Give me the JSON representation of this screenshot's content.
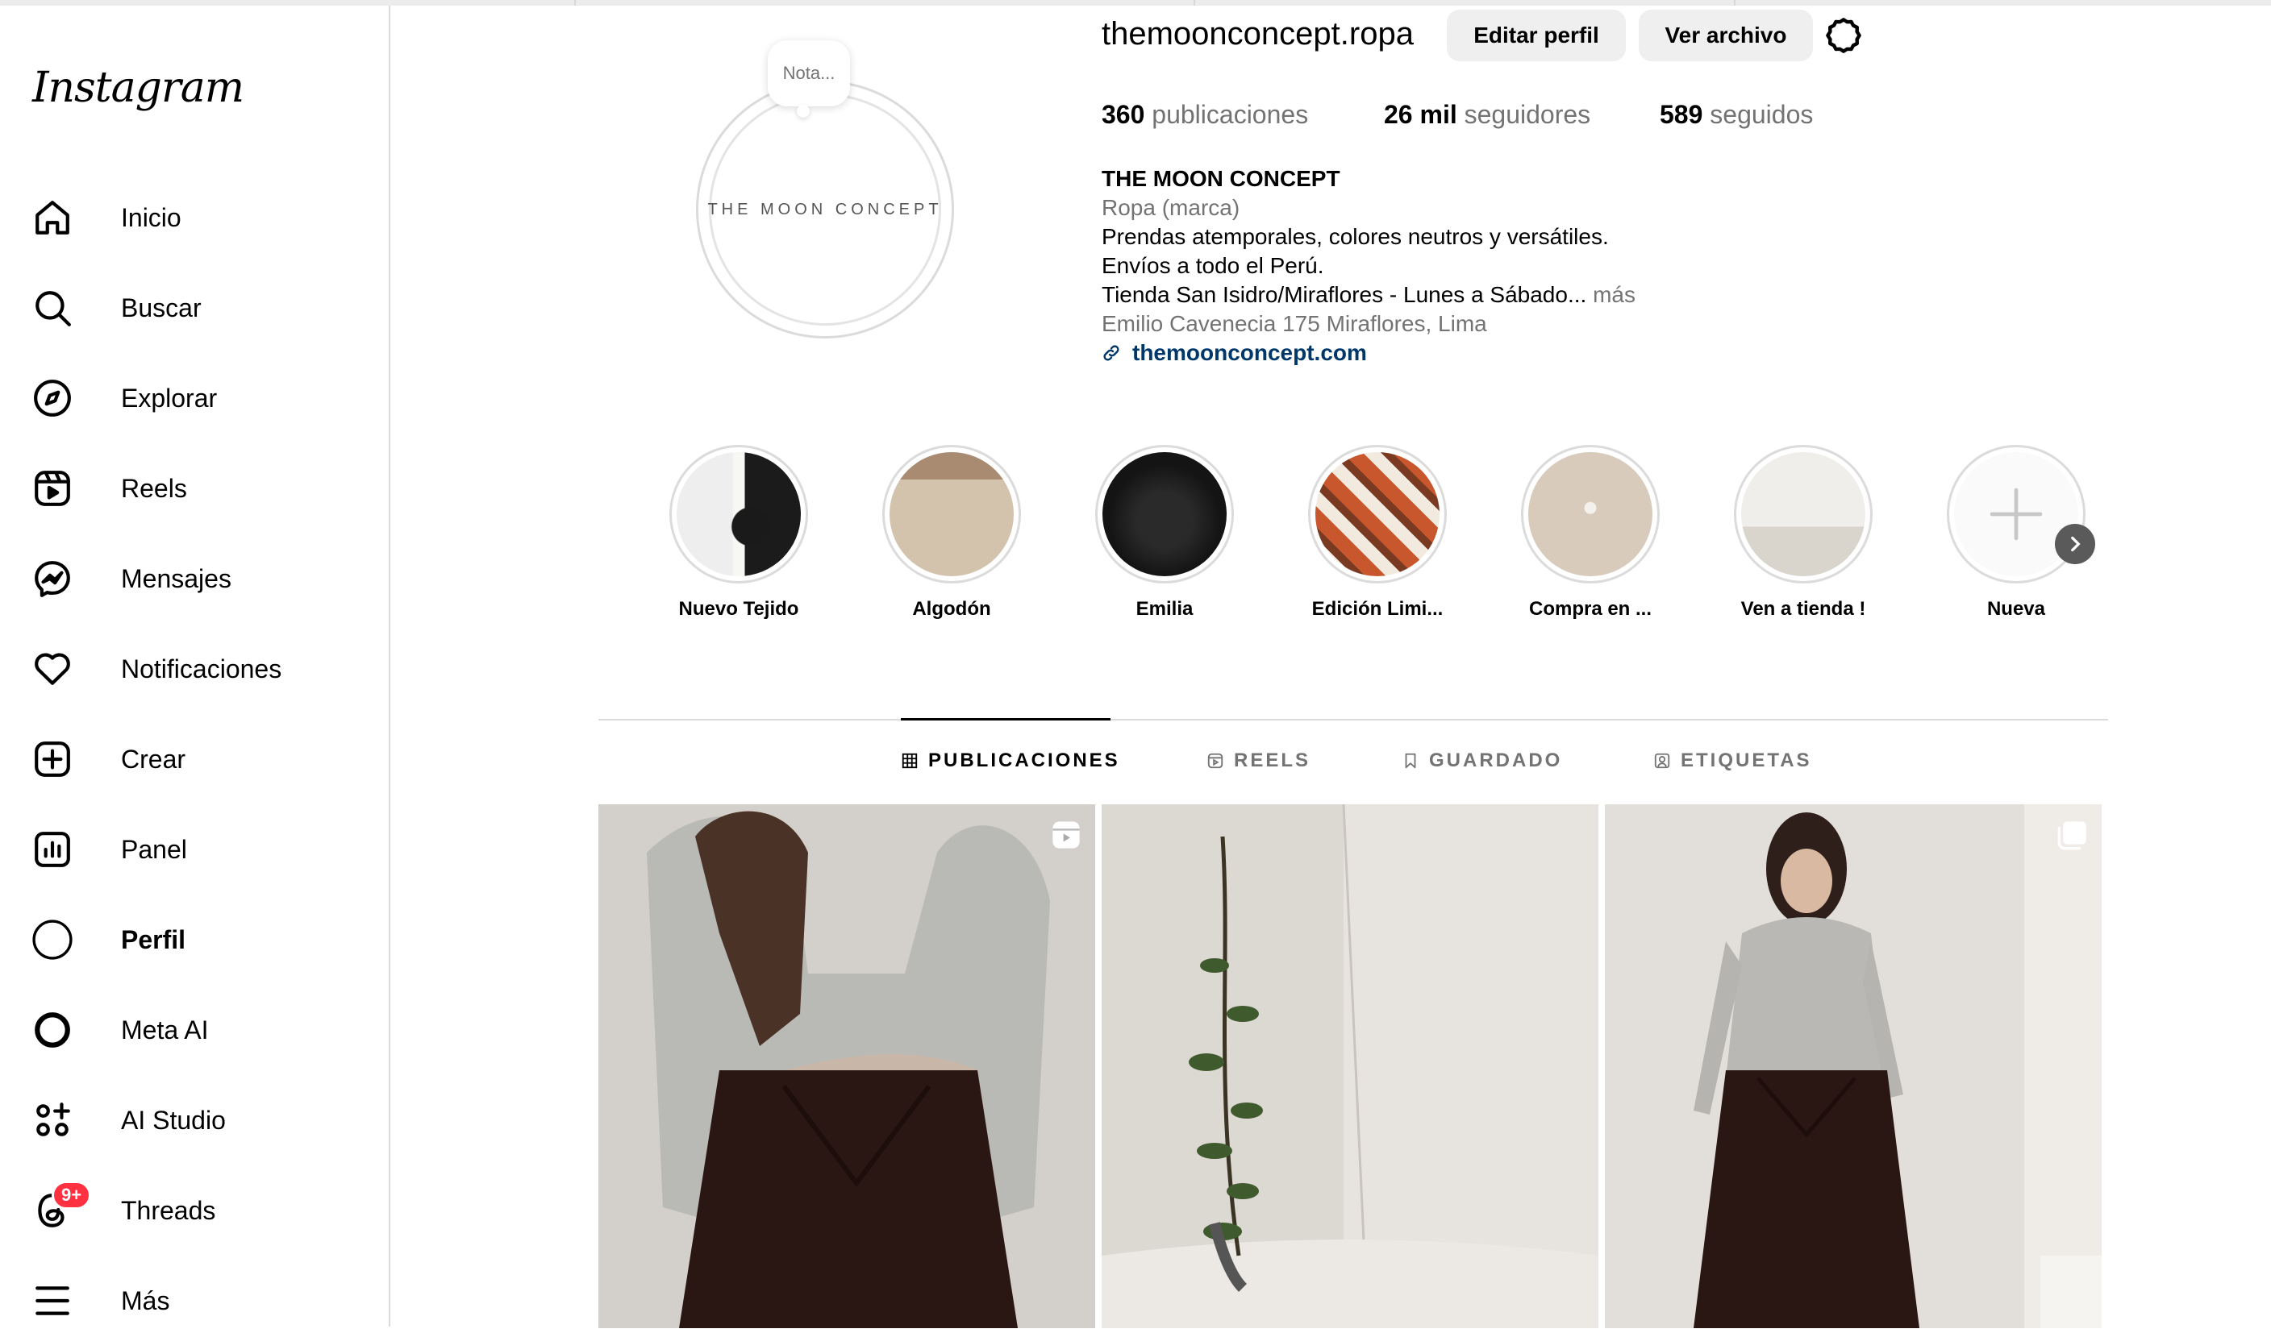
{
  "sidebar": {
    "logo": "Instagram",
    "items": [
      {
        "label": "Inicio",
        "icon": "home-icon"
      },
      {
        "label": "Buscar",
        "icon": "search-icon"
      },
      {
        "label": "Explorar",
        "icon": "compass-icon"
      },
      {
        "label": "Reels",
        "icon": "reels-icon"
      },
      {
        "label": "Mensajes",
        "icon": "messenger-icon"
      },
      {
        "label": "Notificaciones",
        "icon": "heart-icon"
      },
      {
        "label": "Crear",
        "icon": "plus-square-icon"
      },
      {
        "label": "Panel",
        "icon": "chart-icon"
      },
      {
        "label": "Perfil",
        "icon": "avatar-icon"
      },
      {
        "label": "Meta AI",
        "icon": "meta-ai-icon"
      },
      {
        "label": "AI Studio",
        "icon": "ai-studio-icon"
      },
      {
        "label": "Threads",
        "icon": "threads-icon",
        "badge": "9+"
      },
      {
        "label": "Más",
        "icon": "menu-icon"
      }
    ]
  },
  "profile": {
    "avatar_text": "THE MOON CONCEPT",
    "note": "Nota...",
    "username": "themoonconcept.ropa",
    "edit_button": "Editar perfil",
    "archive_button": "Ver archivo",
    "stats": {
      "posts_count": "360",
      "posts_label": "publicaciones",
      "followers_count": "26 mil",
      "followers_label": "seguidores",
      "following_count": "589",
      "following_label": "seguidos"
    },
    "bio": {
      "name": "THE MOON CONCEPT",
      "category": "Ropa (marca)",
      "line1": "Prendas atemporales, colores neutros y versátiles.",
      "line2": "Envíos a todo el Perú.",
      "line3": "Tienda San Isidro/Miraflores - Lunes a Sábado...",
      "more": "más",
      "address": "Emilio Cavenecia 175 Miraflores, Lima",
      "link": "themoonconcept.com"
    }
  },
  "highlights": [
    {
      "label": "Nuevo Tejido"
    },
    {
      "label": "Algodón"
    },
    {
      "label": "Emilia"
    },
    {
      "label": "Edición Limi..."
    },
    {
      "label": "Compra en ..."
    },
    {
      "label": "Ven a tienda !"
    },
    {
      "label": "Nueva"
    }
  ],
  "tabs": [
    {
      "label": "PUBLICACIONES",
      "icon": "grid-icon",
      "active": true
    },
    {
      "label": "REELS",
      "icon": "reels-icon",
      "active": false
    },
    {
      "label": "GUARDADO",
      "icon": "bookmark-icon",
      "active": false
    },
    {
      "label": "ETIQUETAS",
      "icon": "tag-user-icon",
      "active": false
    }
  ],
  "posts": [
    {
      "type": "reel",
      "icon": "reel-badge-icon"
    },
    {
      "type": "photo"
    },
    {
      "type": "carousel",
      "icon": "carousel-badge-icon"
    }
  ]
}
